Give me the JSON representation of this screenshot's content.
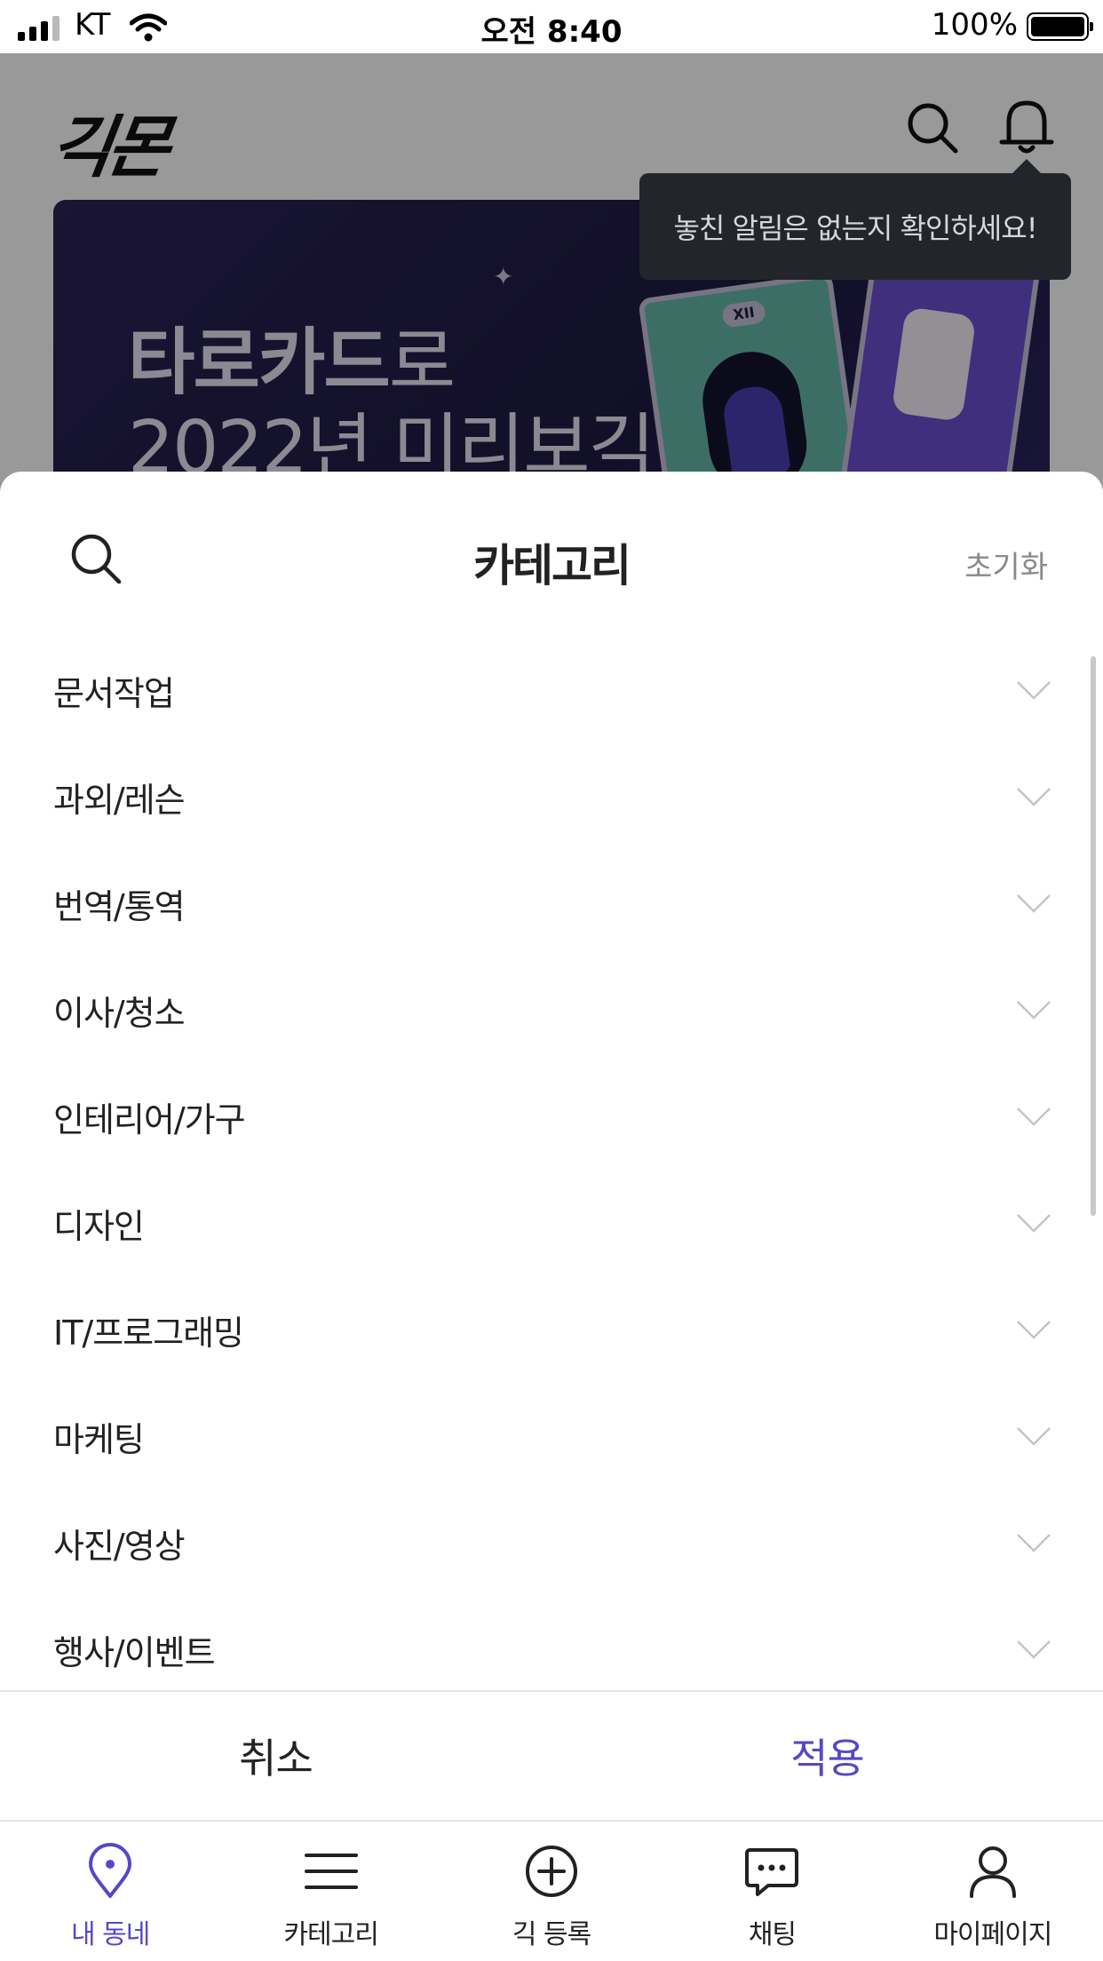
{
  "status_bar": {
    "carrier": "KT",
    "time": "오전 8:40",
    "battery": "100%"
  },
  "header": {
    "logo": "긱몬"
  },
  "banner": {
    "line1_bold": "타로카드",
    "line1_rest": "로",
    "line2": "2022년 미리보긱",
    "card_numeral": "XII"
  },
  "tooltip": {
    "text": "놓친 알림은 없는지 확인하세요!"
  },
  "sheet": {
    "title": "카테고리",
    "reset_label": "초기화",
    "categories": [
      "문서작업",
      "과외/레슨",
      "번역/통역",
      "이사/청소",
      "인테리어/가구",
      "디자인",
      "IT/프로그래밍",
      "마케팅",
      "사진/영상",
      "행사/이벤트"
    ],
    "cancel_label": "취소",
    "apply_label": "적용"
  },
  "tabbar": {
    "items": [
      {
        "label": "내 동네",
        "icon": "location-pin-icon",
        "active": true
      },
      {
        "label": "카테고리",
        "icon": "menu-icon",
        "active": false
      },
      {
        "label": "긱 등록",
        "icon": "plus-circle-icon",
        "active": false
      },
      {
        "label": "채팅",
        "icon": "chat-bubble-icon",
        "active": false
      },
      {
        "label": "마이페이지",
        "icon": "person-icon",
        "active": false
      }
    ]
  },
  "colors": {
    "accent": "#5548c6",
    "tooltip_bg": "#22262b",
    "banner_bg": "#1f1a44"
  }
}
